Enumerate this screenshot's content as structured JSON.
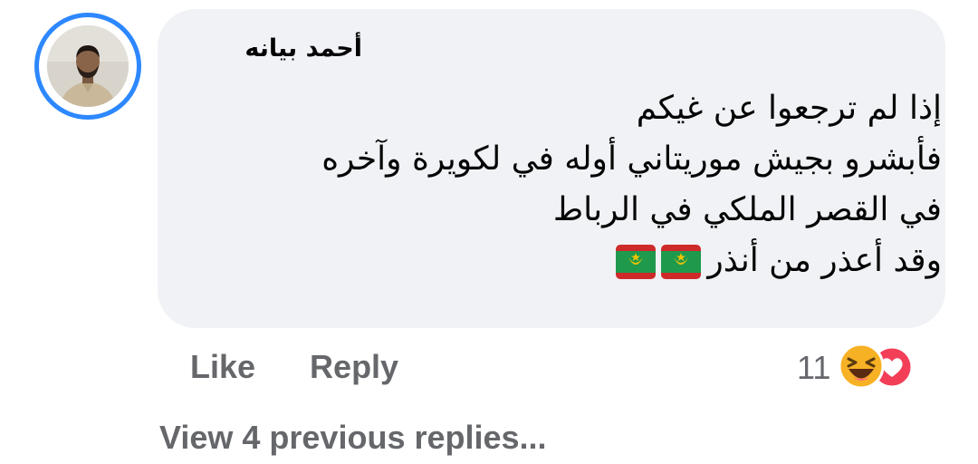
{
  "comment": {
    "author": "أحمد بيانه",
    "lines": [
      "إذا لم ترجعوا عن غيكم",
      "فأبشرو بجيش موريتاني أوله في لكويرة وآخره",
      "في القصر الملكي في الرباط",
      "وقد أعذر من أنذر"
    ],
    "flag_icon": "mauritania-flag-icon",
    "flag_count": 2
  },
  "actions": {
    "like_label": "Like",
    "reply_label": "Reply"
  },
  "reactions": {
    "count": "11",
    "icons": [
      "haha-icon",
      "love-icon"
    ]
  },
  "replies": {
    "view_previous_label": "View 4 previous replies..."
  },
  "colors": {
    "bubble": "#f0f2f5",
    "avatar_ring": "#2d88ff",
    "secondary_text": "#65676b",
    "love": "#f33e58",
    "haha": "#f7b125"
  }
}
